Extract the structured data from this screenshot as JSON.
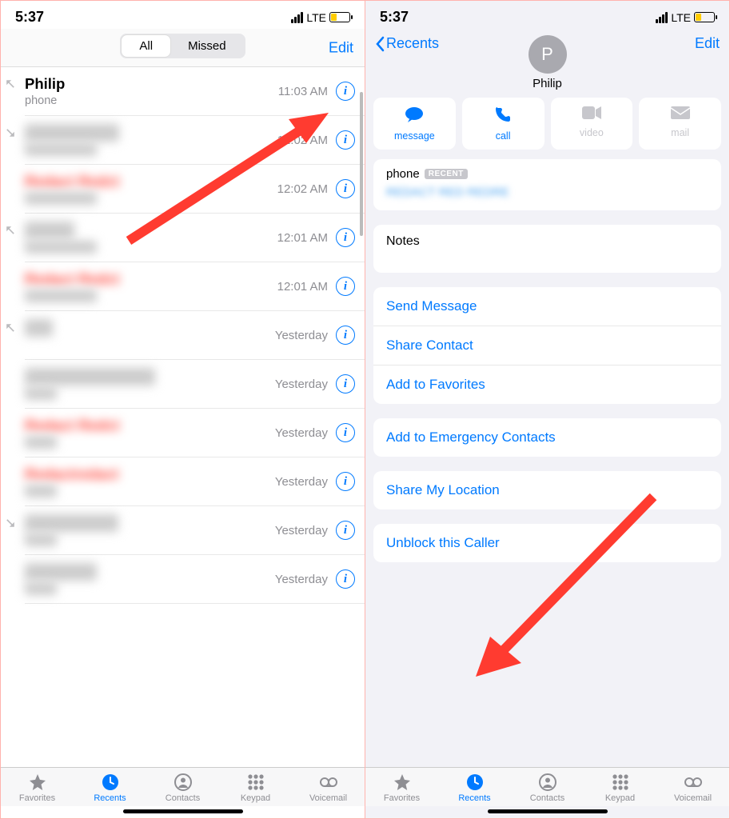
{
  "status": {
    "time": "5:37",
    "carrier": "LTE"
  },
  "left": {
    "tabs": {
      "all": "All",
      "missed": "Missed"
    },
    "edit": "Edit",
    "calls": [
      {
        "name": "Philip",
        "sub": "phone",
        "time": "11:03 AM",
        "missed": false,
        "icon": "incoming",
        "clear": true
      },
      {
        "name": "Redact Redct",
        "sub": "redact red red",
        "time": "12:02 AM",
        "missed": false,
        "icon": "outgoing"
      },
      {
        "name": "Redact Redct",
        "sub": "redact red red",
        "time": "12:02 AM",
        "missed": true
      },
      {
        "name": "Redact",
        "sub": "redact red red",
        "time": "12:01 AM",
        "missed": false,
        "icon": "incoming"
      },
      {
        "name": "Redact Redct",
        "sub": "redact red red",
        "time": "12:01 AM",
        "missed": true
      },
      {
        "name": "Red",
        "sub": "",
        "time": "Yesterday",
        "missed": false,
        "icon": "incoming"
      },
      {
        "name": "Redact RD REDRE",
        "sub": "redact",
        "time": "Yesterday",
        "missed": false
      },
      {
        "name": "Redact Redct",
        "sub": "redact",
        "time": "Yesterday",
        "missed": true
      },
      {
        "name": "Redactredact",
        "sub": "redact",
        "time": "Yesterday",
        "missed": true
      },
      {
        "name": "Redactredact",
        "sub": "redact",
        "time": "Yesterday",
        "missed": false,
        "icon": "outgoing"
      },
      {
        "name": "Redactred",
        "sub": "redact",
        "time": "Yesterday",
        "missed": false
      }
    ]
  },
  "right": {
    "back": "Recents",
    "name": "Philip",
    "initial": "P",
    "edit": "Edit",
    "actions": [
      {
        "key": "message",
        "label": "message",
        "enabled": true
      },
      {
        "key": "call",
        "label": "call",
        "enabled": true
      },
      {
        "key": "video",
        "label": "video",
        "enabled": false
      },
      {
        "key": "mail",
        "label": "mail",
        "enabled": false
      }
    ],
    "phone": {
      "label": "phone",
      "badge": "RECENT",
      "number": "REDACT RED  REDRE"
    },
    "notes": "Notes",
    "options1": [
      "Send Message",
      "Share Contact",
      "Add to Favorites"
    ],
    "options2": [
      "Add to Emergency Contacts"
    ],
    "options3": [
      "Share My Location"
    ],
    "options4": [
      "Unblock this Caller"
    ]
  },
  "tabs": {
    "items": [
      {
        "key": "favorites",
        "label": "Favorites"
      },
      {
        "key": "recents",
        "label": "Recents"
      },
      {
        "key": "contacts",
        "label": "Contacts"
      },
      {
        "key": "keypad",
        "label": "Keypad"
      },
      {
        "key": "voicemail",
        "label": "Voicemail"
      }
    ],
    "active": "recents"
  }
}
